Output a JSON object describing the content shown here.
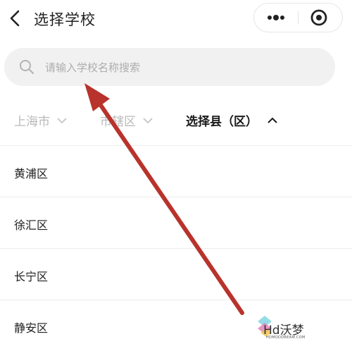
{
  "header": {
    "title": "选择学校",
    "back_icon": "chevron-left-icon",
    "more_icon": "more-dots-icon",
    "close_icon": "target-close-icon"
  },
  "search": {
    "placeholder": "请输入学校名称搜索",
    "value": "",
    "icon": "search-icon"
  },
  "filters": [
    {
      "label": "上海市",
      "state": "collapsed",
      "active": false
    },
    {
      "label": "市辖区",
      "state": "collapsed",
      "active": false
    },
    {
      "label": "选择县（区）",
      "state": "expanded",
      "active": true
    }
  ],
  "districts": [
    "黄浦区",
    "徐汇区",
    "长宁区",
    "静安区"
  ],
  "annotation": {
    "type": "arrow",
    "color": "#b8332c"
  },
  "watermark": {
    "text": "Hd沃梦",
    "sub": "HDMODDREAM.COM"
  },
  "colors": {
    "accent_arrow": "#b8332c",
    "search_bg": "#f1f1f1",
    "inactive_text": "#b9b9b9"
  }
}
